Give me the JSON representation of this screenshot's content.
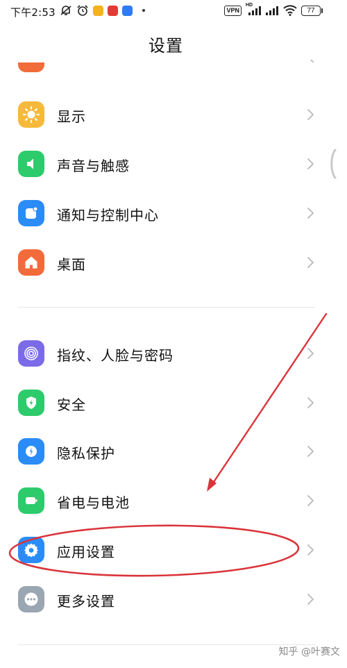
{
  "status_bar": {
    "time": "下午2:53",
    "hd_label": "HD",
    "vpn_label": "VPN",
    "battery_level": "77",
    "icons": [
      "mute-icon",
      "alarm-icon",
      "app-notification-icon",
      "app-notification-icon",
      "app-notification-icon",
      "vpn-icon",
      "signal-icon",
      "signal-icon",
      "wifi-icon",
      "battery-icon"
    ]
  },
  "header": {
    "title": "设置"
  },
  "settings": {
    "items": [
      {
        "label": "显示",
        "icon": "brightness-icon",
        "color": "#F6B93B"
      },
      {
        "label": "声音与触感",
        "icon": "speaker-icon",
        "color": "#2DCB6B"
      },
      {
        "label": "通知与控制中心",
        "icon": "notification-icon",
        "color": "#2B8CF7"
      },
      {
        "label": "桌面",
        "icon": "home-icon",
        "color": "#F26B3A"
      },
      {
        "label": "指纹、人脸与密码",
        "icon": "fingerprint-icon",
        "color": "#7B6BE8"
      },
      {
        "label": "安全",
        "icon": "shield-icon",
        "color": "#2DCB6B"
      },
      {
        "label": "隐私保护",
        "icon": "privacy-icon",
        "color": "#2B8CF7"
      },
      {
        "label": "省电与电池",
        "icon": "battery-saver-icon",
        "color": "#2DCB6B"
      },
      {
        "label": "应用设置",
        "icon": "gear-icon",
        "color": "#2B8CF7"
      },
      {
        "label": "更多设置",
        "icon": "more-icon",
        "color": "#9AA6B2"
      }
    ]
  },
  "annotation": {
    "color": "#D9343A"
  },
  "watermark": {
    "text": "知乎 @叶赛文"
  }
}
